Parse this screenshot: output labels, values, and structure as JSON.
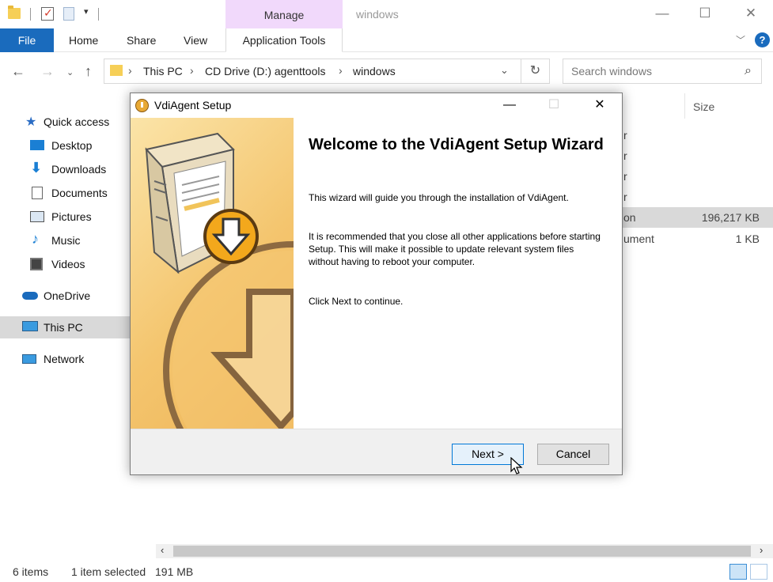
{
  "window": {
    "title": "windows",
    "context_tab": "Manage",
    "minimize": "—",
    "maximize": "☐",
    "close": "✕"
  },
  "ribbon": {
    "tabs": [
      "File",
      "Home",
      "Share",
      "View",
      "Application Tools"
    ],
    "file_color": "#1a6bbd"
  },
  "address": {
    "breadcrumb": [
      "This PC",
      "CD Drive (D:) agenttools",
      "windows"
    ],
    "search_placeholder": "Search windows"
  },
  "sidebar": {
    "items": [
      {
        "label": "Quick access",
        "icon": "star-icon"
      },
      {
        "label": "Desktop",
        "icon": "desktop-icon"
      },
      {
        "label": "Downloads",
        "icon": "download-icon"
      },
      {
        "label": "Documents",
        "icon": "documents-icon"
      },
      {
        "label": "Pictures",
        "icon": "pictures-icon"
      },
      {
        "label": "Music",
        "icon": "music-icon"
      },
      {
        "label": "Videos",
        "icon": "videos-icon"
      },
      {
        "label": "OneDrive",
        "icon": "cloud-icon"
      },
      {
        "label": "This PC",
        "icon": "computer-icon",
        "selected": true
      },
      {
        "label": "Network",
        "icon": "network-icon"
      }
    ]
  },
  "file_list": {
    "size_header": "Size",
    "partial_types": [
      "r",
      "r",
      "r",
      "r",
      "on",
      "ument"
    ],
    "sizes": [
      "196,217 KB",
      "1 KB"
    ]
  },
  "status": {
    "items": "6 items",
    "selection": "1 item selected",
    "size": "191 MB"
  },
  "dialog": {
    "title": "VdiAgent Setup",
    "heading": "Welcome to the VdiAgent Setup Wizard",
    "para1": "This wizard will guide you through the installation of VdiAgent.",
    "para2": "It is recommended that you close all other applications before starting Setup. This will make it possible to update relevant system files without having to reboot your computer.",
    "para3": "Click Next to continue.",
    "next_label": "Next >",
    "cancel_label": "Cancel"
  }
}
